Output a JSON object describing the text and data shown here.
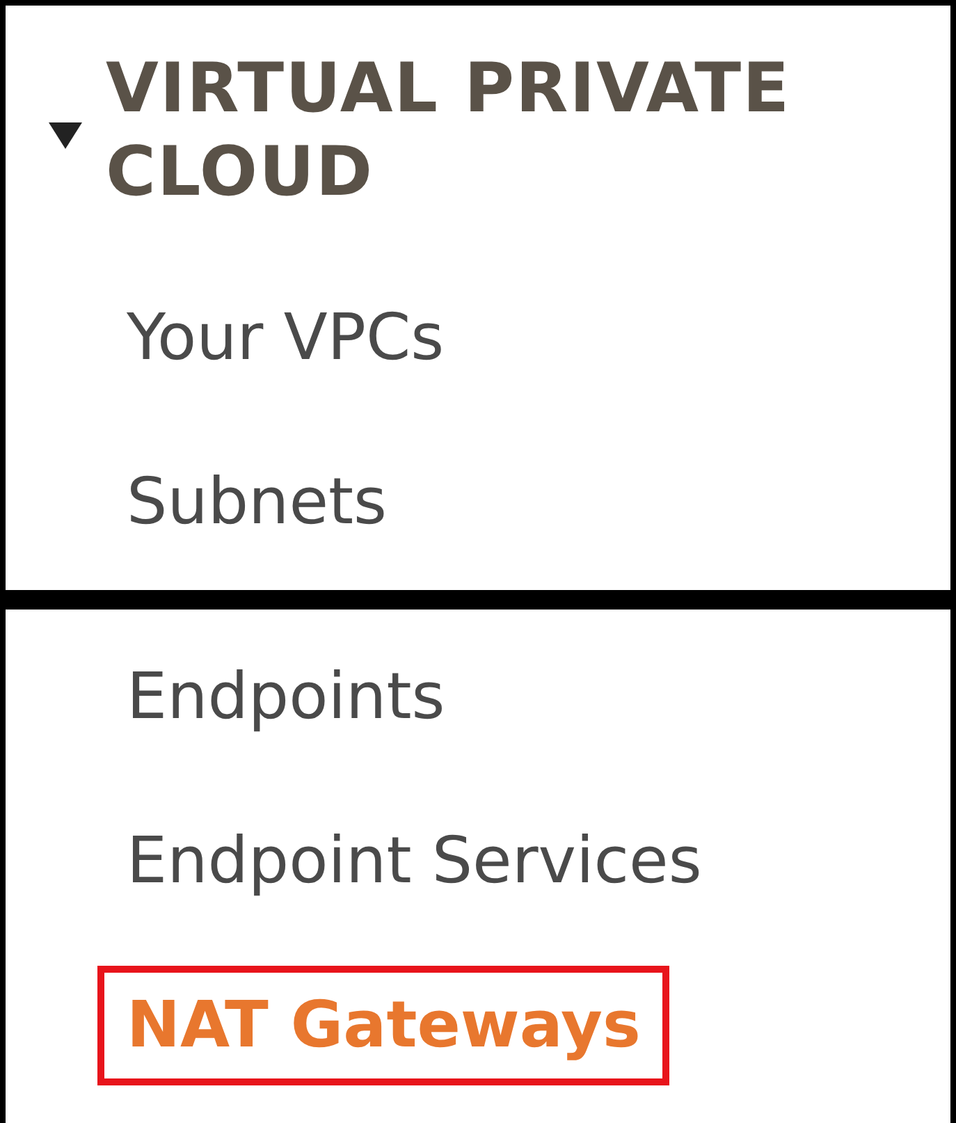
{
  "section": {
    "title": "VIRTUAL PRIVATE CLOUD",
    "expanded": true
  },
  "groups": [
    {
      "items": [
        {
          "label": "Your VPCs",
          "selected": false
        },
        {
          "label": "Subnets",
          "selected": false
        }
      ]
    },
    {
      "items": [
        {
          "label": "Endpoints",
          "selected": false
        },
        {
          "label": "Endpoint Services",
          "selected": false
        },
        {
          "label": "NAT Gateways",
          "selected": true
        }
      ]
    }
  ]
}
